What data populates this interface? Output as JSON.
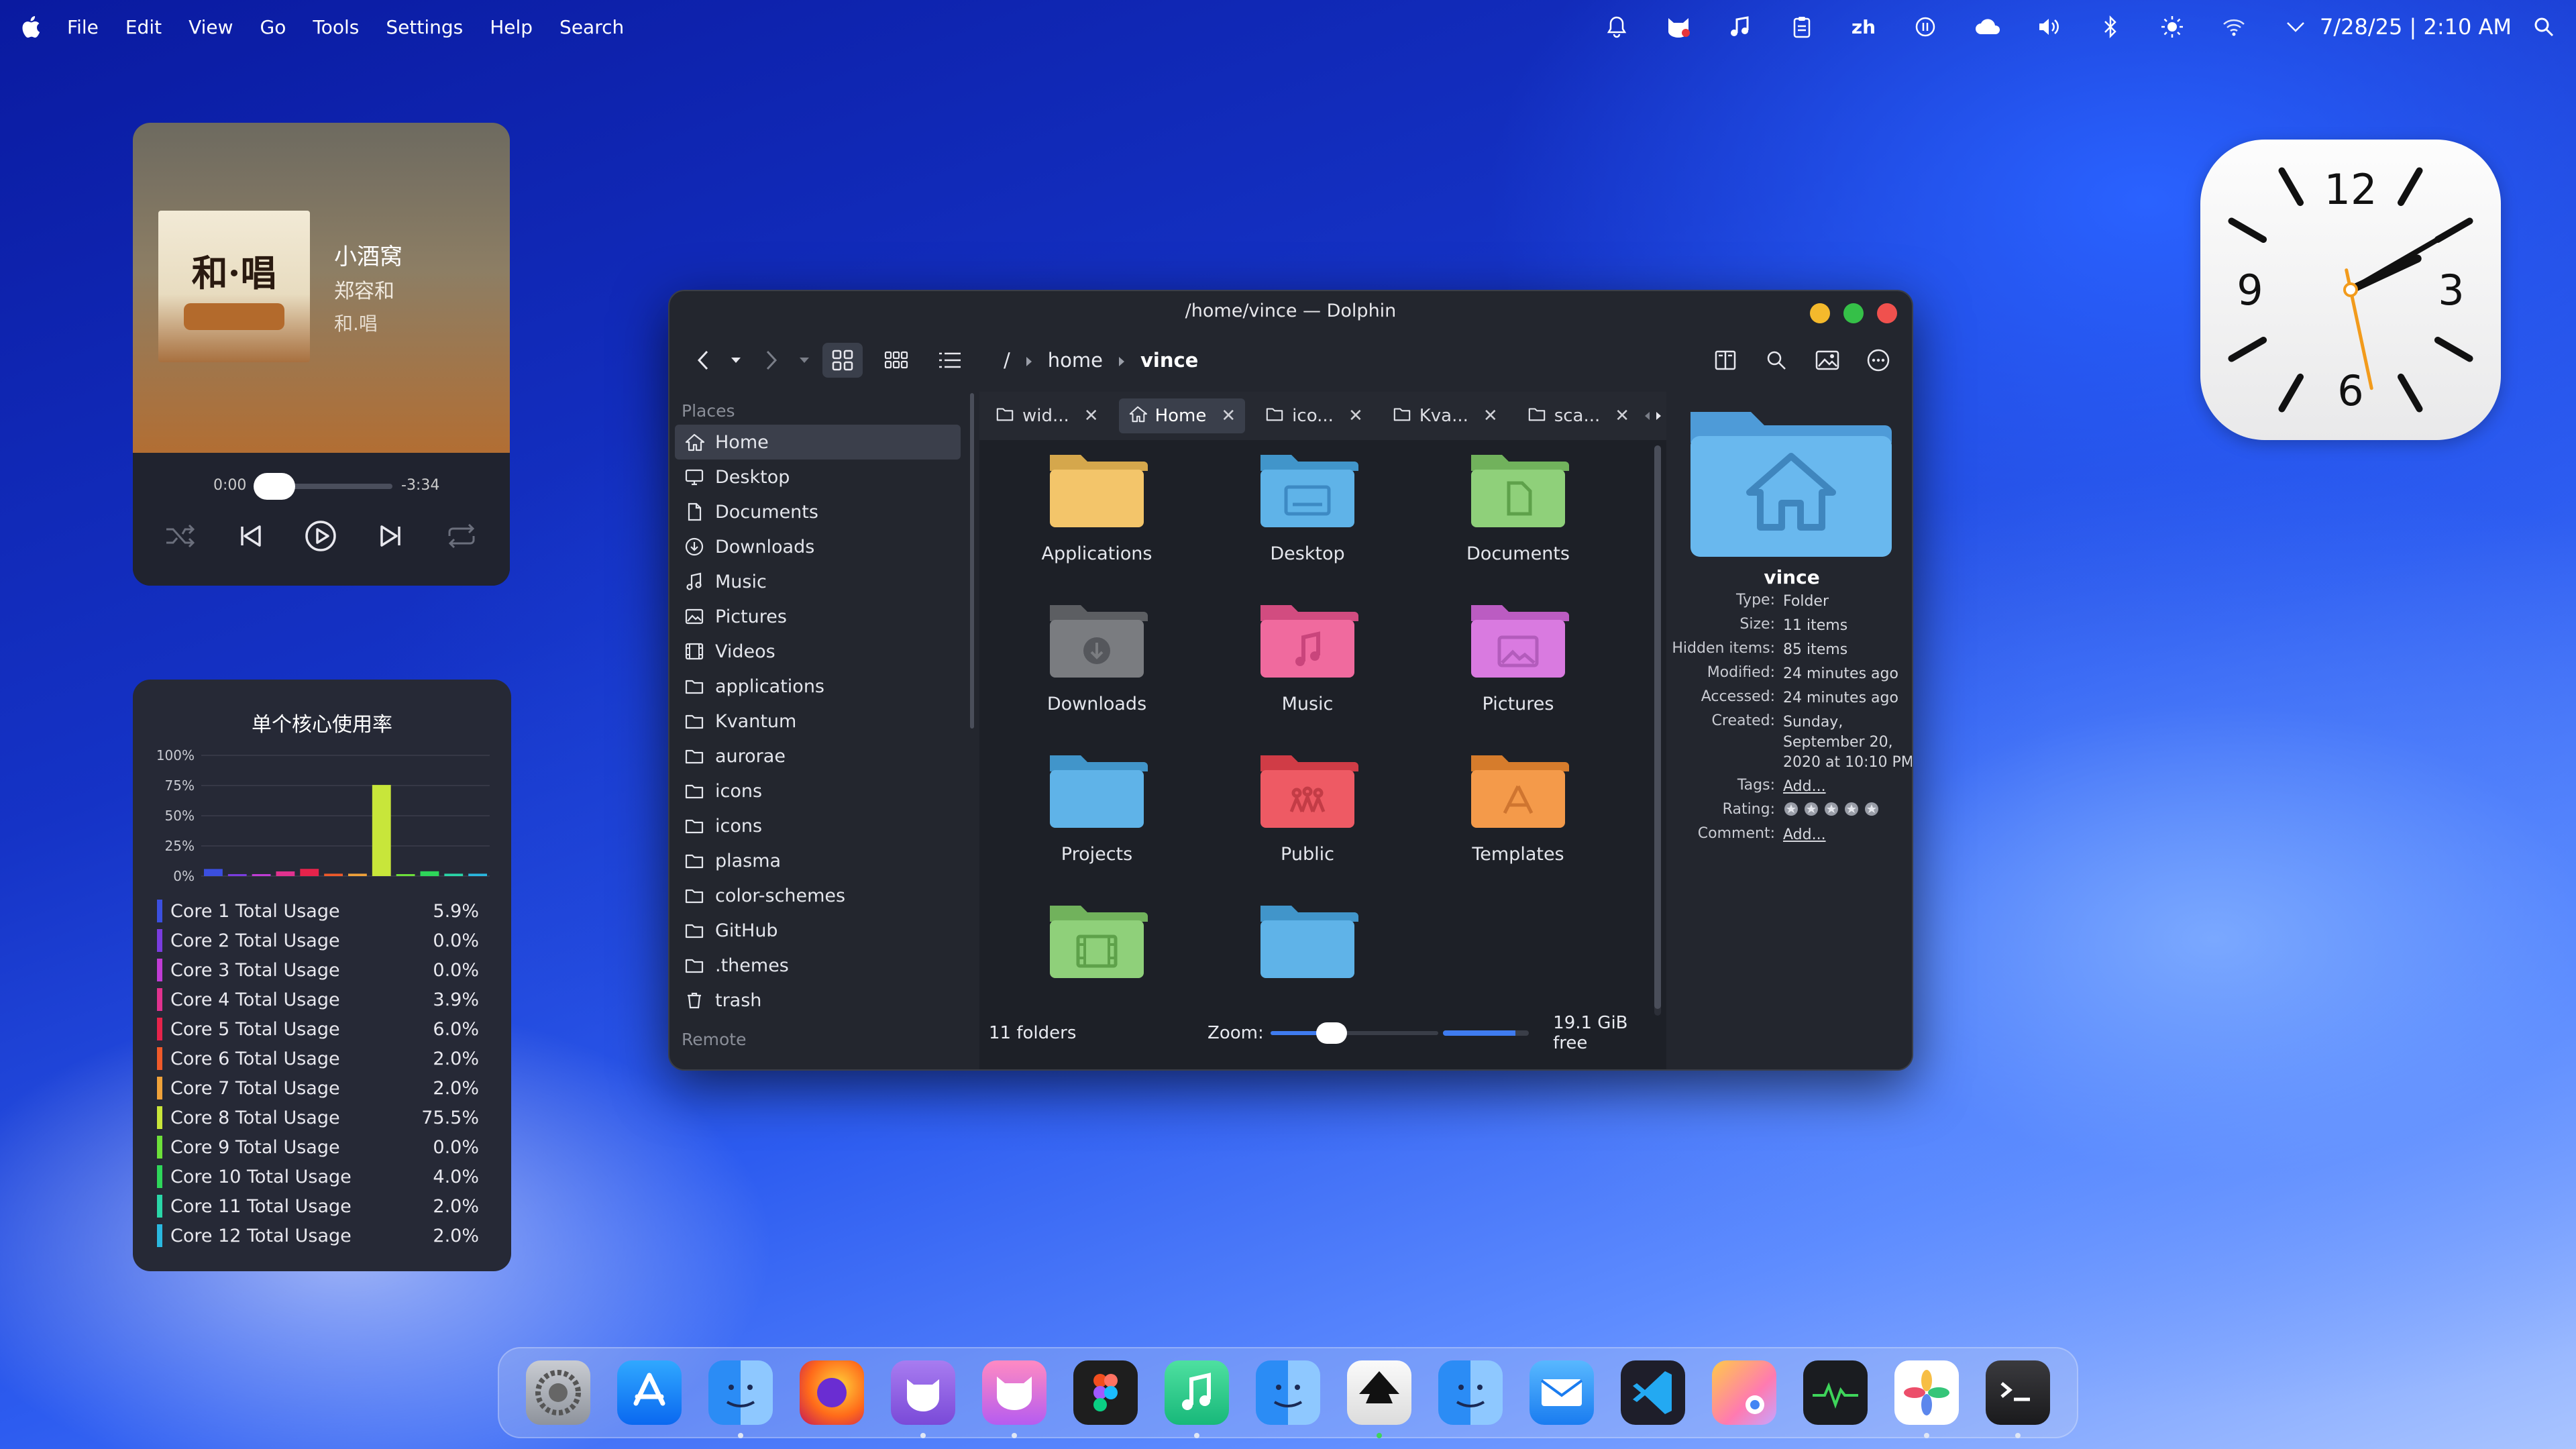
{
  "menubar": {
    "items": [
      "File",
      "Edit",
      "View",
      "Go",
      "Tools",
      "Settings",
      "Help",
      "Search"
    ],
    "tray": {
      "lang": "zh",
      "datetime": "7/28/25 | 2:10 AM"
    }
  },
  "music": {
    "song": "小酒窝",
    "artist": "郑容和",
    "album": "和.唱",
    "cover_text": "和·唱",
    "elapsed": "0:00",
    "remaining": "-3:34",
    "progress": 0.02
  },
  "cpu": {
    "title": "单个核心使用率",
    "chart_data": {
      "type": "bar",
      "categories": [
        "Core 1",
        "Core 2",
        "Core 3",
        "Core 4",
        "Core 5",
        "Core 6",
        "Core 7",
        "Core 8",
        "Core 9",
        "Core 10",
        "Core 11",
        "Core 12"
      ],
      "values": [
        5.9,
        0.0,
        0.0,
        3.9,
        6.0,
        2.0,
        2.0,
        75.5,
        0.0,
        4.0,
        2.0,
        2.0
      ],
      "y_ticks": [
        "100%",
        "75%",
        "50%",
        "25%",
        "0%"
      ],
      "ylim": [
        0,
        100
      ]
    },
    "rows": [
      {
        "name": "Core 1 Total Usage",
        "value": "5.9%",
        "color": "#3b4fe0"
      },
      {
        "name": "Core 2 Total Usage",
        "value": "0.0%",
        "color": "#7a3ce0"
      },
      {
        "name": "Core 3 Total Usage",
        "value": "0.0%",
        "color": "#c03cd6"
      },
      {
        "name": "Core 4 Total Usage",
        "value": "3.9%",
        "color": "#e0328f"
      },
      {
        "name": "Core 5 Total Usage",
        "value": "6.0%",
        "color": "#e6234b"
      },
      {
        "name": "Core 6 Total Usage",
        "value": "2.0%",
        "color": "#ef5a2a"
      },
      {
        "name": "Core 7 Total Usage",
        "value": "2.0%",
        "color": "#f0a23a"
      },
      {
        "name": "Core 8 Total Usage",
        "value": "75.5%",
        "color": "#c8e63a"
      },
      {
        "name": "Core 9 Total Usage",
        "value": "0.0%",
        "color": "#6de03a"
      },
      {
        "name": "Core 10 Total Usage",
        "value": "4.0%",
        "color": "#2ed65a"
      },
      {
        "name": "Core 11 Total Usage",
        "value": "2.0%",
        "color": "#2ad6a8"
      },
      {
        "name": "Core 12 Total Usage",
        "value": "2.0%",
        "color": "#2ab8e0"
      }
    ]
  },
  "clock": {
    "hour": 2,
    "minute": 10,
    "second": 28,
    "numerals": [
      "12",
      "3",
      "6",
      "9"
    ]
  },
  "dolphin": {
    "title": "/home/vince — Dolphin",
    "breadcrumb": {
      "root": "/",
      "parent": "home",
      "current": "vince"
    },
    "places_header": "Places",
    "remote_header": "Remote",
    "places": [
      {
        "label": "Home",
        "icon": "home-icon",
        "selected": true
      },
      {
        "label": "Desktop",
        "icon": "desktop-icon"
      },
      {
        "label": "Documents",
        "icon": "document-icon"
      },
      {
        "label": "Downloads",
        "icon": "download-icon"
      },
      {
        "label": "Music",
        "icon": "music-note-icon"
      },
      {
        "label": "Pictures",
        "icon": "picture-icon"
      },
      {
        "label": "Videos",
        "icon": "video-icon"
      },
      {
        "label": "applications",
        "icon": "folder-icon"
      },
      {
        "label": "Kvantum",
        "icon": "folder-icon"
      },
      {
        "label": "aurorae",
        "icon": "folder-icon"
      },
      {
        "label": "icons",
        "icon": "folder-icon"
      },
      {
        "label": "icons",
        "icon": "folder-icon"
      },
      {
        "label": "plasma",
        "icon": "folder-icon"
      },
      {
        "label": "color-schemes",
        "icon": "folder-icon"
      },
      {
        "label": "GitHub",
        "icon": "folder-icon"
      },
      {
        "label": ".themes",
        "icon": "folder-icon"
      },
      {
        "label": "trash",
        "icon": "trash-icon"
      }
    ],
    "tabs": [
      {
        "label": "wid...",
        "selected": false
      },
      {
        "label": "Home",
        "selected": true
      },
      {
        "label": "ico...",
        "selected": false
      },
      {
        "label": "Kva...",
        "selected": false
      },
      {
        "label": "sca...",
        "selected": false
      }
    ],
    "files": [
      {
        "label": "Applications",
        "color": "#f3c56a",
        "glyph": ""
      },
      {
        "label": "Desktop",
        "color": "#5fb3e8",
        "glyph": "desktop"
      },
      {
        "label": "Documents",
        "color": "#8fd07a",
        "glyph": "doc"
      },
      {
        "label": "Downloads",
        "color": "#7a7c80",
        "glyph": "download"
      },
      {
        "label": "Music",
        "color": "#f06a9e",
        "glyph": "music"
      },
      {
        "label": "Pictures",
        "color": "#d97ae0",
        "glyph": "picture"
      },
      {
        "label": "Projects",
        "color": "#5fb3e8",
        "glyph": ""
      },
      {
        "label": "Public",
        "color": "#ee5a64",
        "glyph": "people"
      },
      {
        "label": "Templates",
        "color": "#f49a4a",
        "glyph": "template"
      },
      {
        "label": "",
        "color": "#8fd07a",
        "glyph": "film"
      },
      {
        "label": "",
        "color": "#5fb3e8",
        "glyph": ""
      }
    ],
    "status": {
      "count": "11 folders",
      "zoom_label": "Zoom:",
      "free": "19.1 GiB free"
    },
    "info": {
      "name": "vince",
      "rows": [
        {
          "k": "Type:",
          "v": "Folder"
        },
        {
          "k": "Size:",
          "v": "11 items"
        },
        {
          "k": "Hidden items:",
          "v": "85 items"
        },
        {
          "k": "Modified:",
          "v": "24 minutes ago"
        },
        {
          "k": "Accessed:",
          "v": "24 minutes ago"
        },
        {
          "k": "Created:",
          "v": "Sunday, September 20, 2020 at 10:10 PM"
        },
        {
          "k": "Tags:",
          "v": "Add...",
          "link": true
        },
        {
          "k": "Rating:",
          "v": "",
          "stars": true
        },
        {
          "k": "Comment:",
          "v": "Add...",
          "link": true
        }
      ]
    }
  },
  "dock": [
    "system-settings",
    "app-store",
    "finder",
    "firefox",
    "github",
    "cat-app",
    "figma",
    "music",
    "finder",
    "inkscape",
    "finder",
    "mail",
    "vscode",
    "chrome",
    "activity-monitor",
    "photos",
    "terminal"
  ]
}
